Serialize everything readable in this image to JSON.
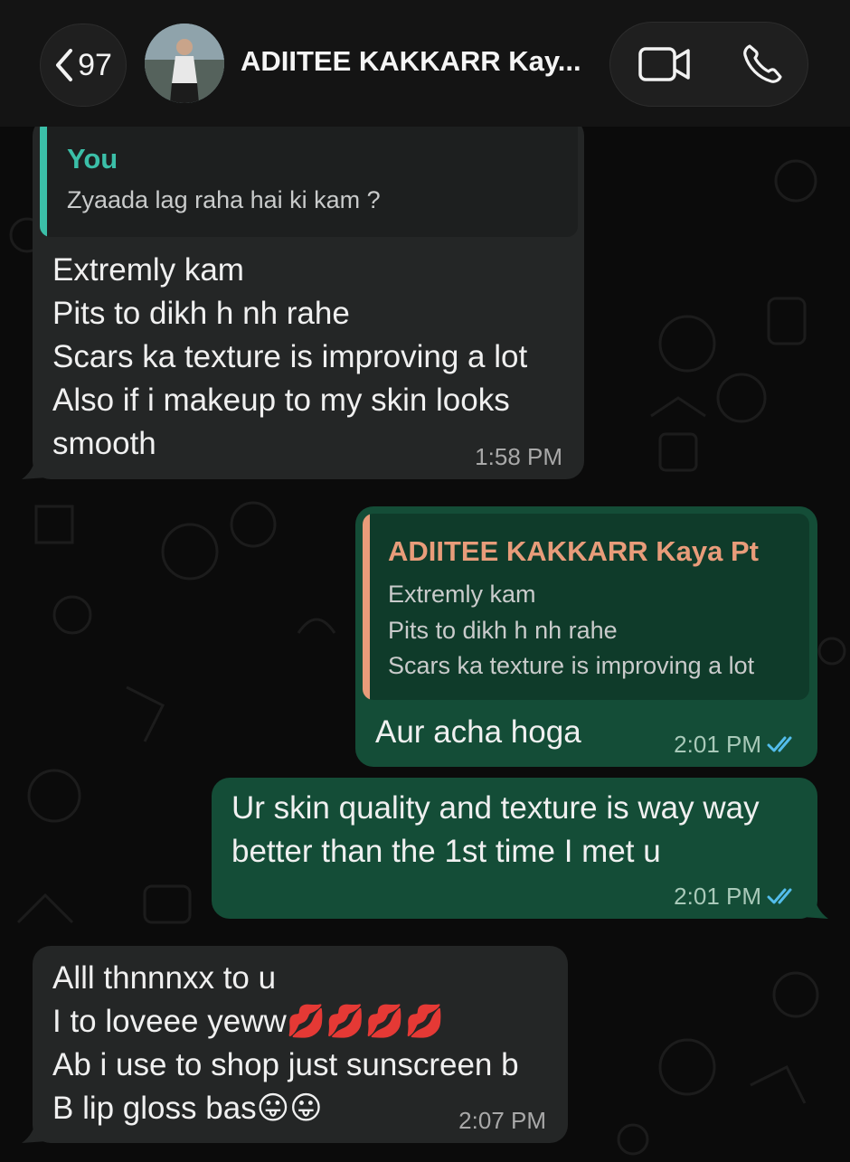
{
  "header": {
    "back_count": "97",
    "contact_name": "ADIITEE KAKKARR Kay...",
    "icons": {
      "back": "chevron-left-icon",
      "video": "video-call-icon",
      "call": "phone-icon"
    }
  },
  "colors": {
    "incoming_bubble": "#242626",
    "outgoing_bubble": "#144d37",
    "quote_self_bar": "#3bbfa8",
    "quote_contact_bar": "#e89c7a",
    "read_ticks": "#53bdeb"
  },
  "messages": [
    {
      "direction": "in",
      "quote": {
        "author": "You",
        "text": "Zyaada lag raha hai ki kam ?"
      },
      "text": "Extremly kam\nPits to dikh h nh rahe\nScars ka texture is improving a lot\nAlso if i makeup to my skin looks\nsmooth",
      "time": "1:58 PM"
    },
    {
      "direction": "out",
      "quote": {
        "author": "ADIITEE KAKKARR Kaya Pt",
        "text": "Extremly kam\nPits to dikh h nh rahe\nScars ka texture is improving a lot"
      },
      "text": "Aur acha hoga",
      "time": "2:01 PM",
      "status": "read"
    },
    {
      "direction": "out",
      "text": "Ur skin quality and texture is way way\nbetter than the 1st time I met u",
      "time": "2:01 PM",
      "status": "read"
    },
    {
      "direction": "in",
      "text": "Alll thnnnxx to u\nI to loveee yeww💋💋💋💋\nAb i use to shop just sunscreen b\nB lip gloss bas😛😛",
      "time": "2:07 PM"
    }
  ]
}
